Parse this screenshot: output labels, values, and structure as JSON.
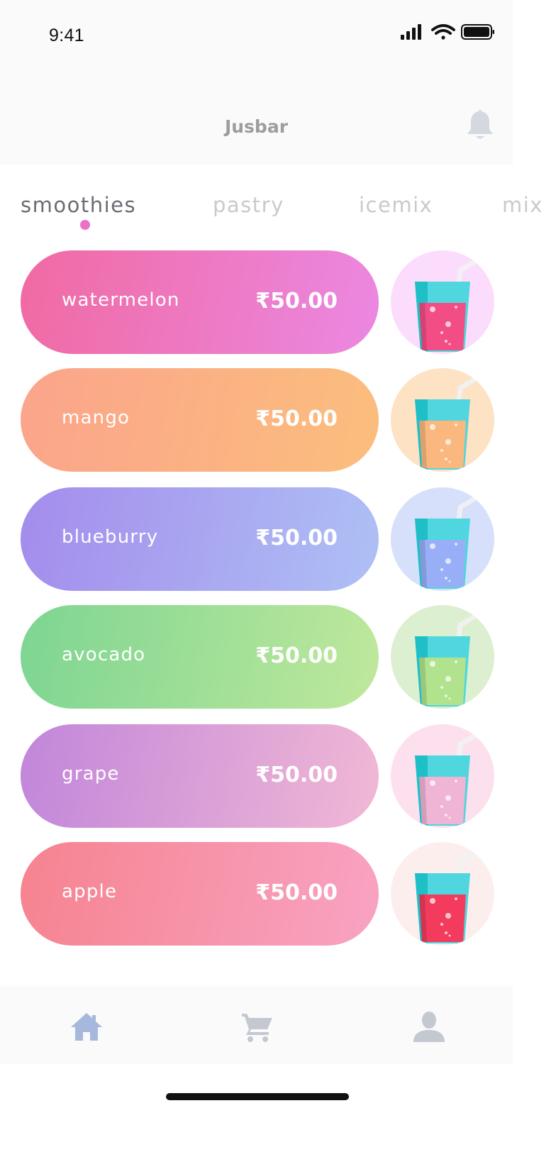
{
  "status_bar": {
    "time": "9:41"
  },
  "header": {
    "title": "Jusbar",
    "bell_icon": "bell-icon"
  },
  "tabs": [
    {
      "label": "smoothies",
      "active": true
    },
    {
      "label": "pastry",
      "active": false
    },
    {
      "label": "icemix",
      "active": false
    },
    {
      "label": "mix",
      "active": false
    }
  ],
  "items": [
    {
      "name": "watermelon",
      "price": "₹50.00",
      "gradient": [
        "#f06aa2",
        "#eb88e2"
      ],
      "circle": "#fcdcfc",
      "juice": "#f24d85"
    },
    {
      "name": "mango",
      "price": "₹50.00",
      "gradient": [
        "#fba48c",
        "#fbbe7c"
      ],
      "circle": "#fde2c3",
      "juice": "#fbb87e"
    },
    {
      "name": "blueburry",
      "price": "₹50.00",
      "gradient": [
        "#a48cec",
        "#aec0f5"
      ],
      "circle": "#d6e0fb",
      "juice": "#98aef6"
    },
    {
      "name": "avocado",
      "price": "₹50.00",
      "gradient": [
        "#7dd592",
        "#bfe89c"
      ],
      "circle": "#dcefd0",
      "juice": "#b1e38f"
    },
    {
      "name": "grape",
      "price": "₹50.00",
      "gradient": [
        "#c186da",
        "#f1b8d5"
      ],
      "circle": "#fce0ee",
      "juice": "#f0b4d4"
    },
    {
      "name": "apple",
      "price": "₹50.00",
      "gradient": [
        "#f6838f",
        "#f8a3c3"
      ],
      "circle": "#fdeeee",
      "juice": "#f33c5d"
    }
  ],
  "bottom_nav": [
    {
      "name": "home-icon",
      "active": true
    },
    {
      "name": "cart-icon",
      "active": false
    },
    {
      "name": "profile-icon",
      "active": false
    }
  ],
  "colors": {
    "accent": "#ea71c8",
    "nav_active": "#a6b9dc",
    "nav_inactive": "#c4c8d0"
  }
}
